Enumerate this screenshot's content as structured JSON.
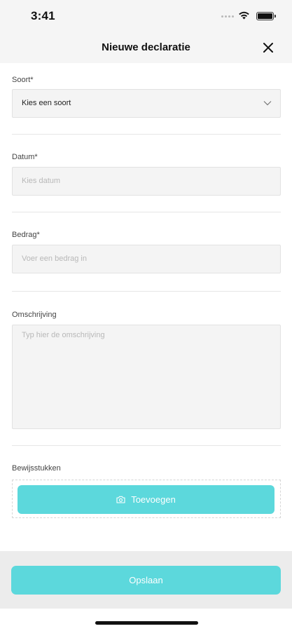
{
  "status_bar": {
    "time": "3:41"
  },
  "header": {
    "title": "Nieuwe declaratie"
  },
  "form": {
    "soort": {
      "label": "Soort*",
      "value": "Kies een soort"
    },
    "datum": {
      "label": "Datum*",
      "placeholder": "Kies datum"
    },
    "bedrag": {
      "label": "Bedrag*",
      "placeholder": "Voer een bedrag in"
    },
    "omschrijving": {
      "label": "Omschrijving",
      "placeholder": "Typ hier de omschrijving"
    },
    "bewijsstukken": {
      "label": "Bewijsstukken",
      "add_label": "Toevoegen"
    }
  },
  "footer": {
    "save_label": "Opslaan"
  },
  "colors": {
    "accent": "#5cd8dc",
    "field_bg": "#f4f4f4",
    "header_bg": "#f5f5f5"
  },
  "icons": {
    "close": "close-icon",
    "chevron": "chevron-down-icon",
    "camera": "camera-icon"
  }
}
